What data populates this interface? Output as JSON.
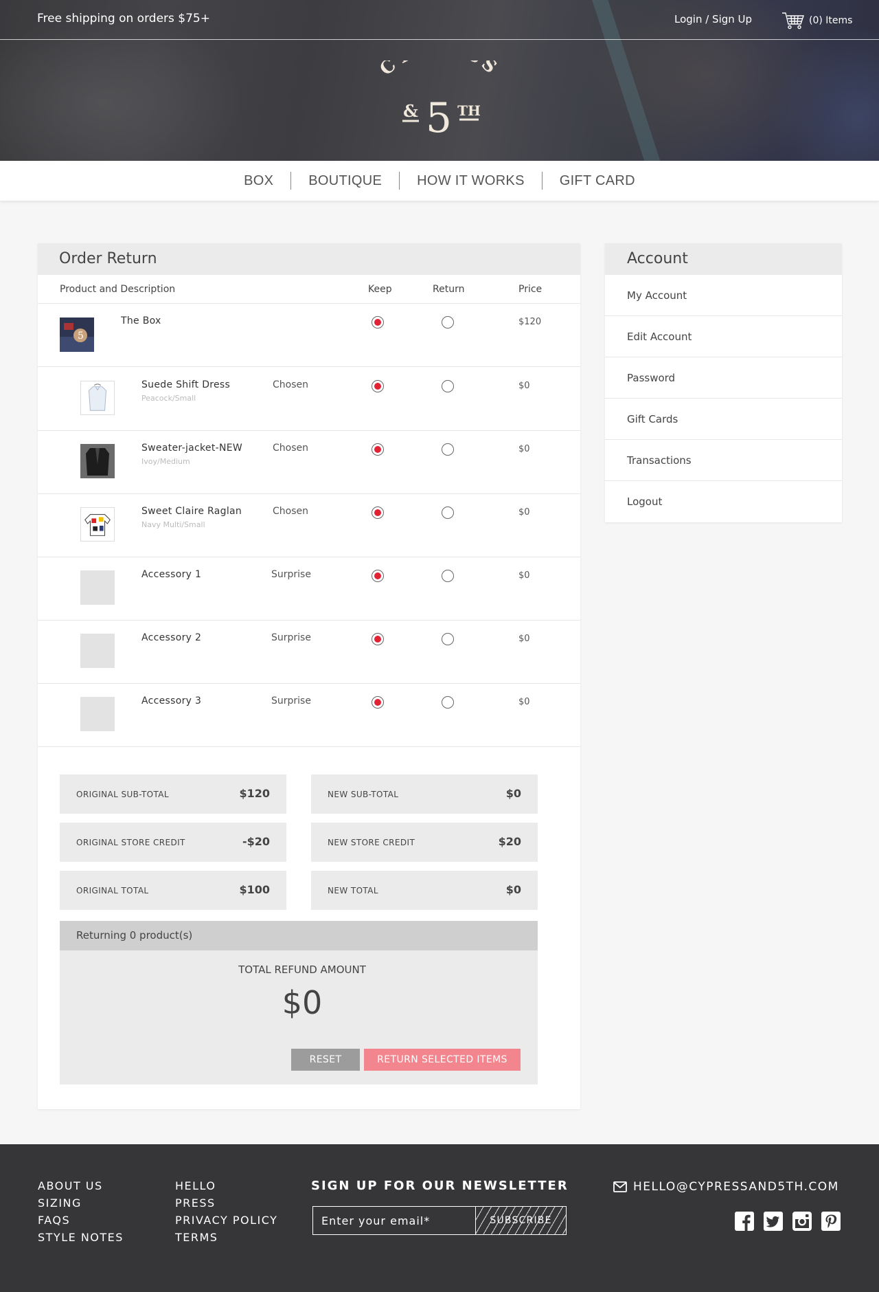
{
  "header": {
    "shipping_text": "Free shipping on orders $75+",
    "login_text": "Login / Sign Up",
    "cart_text": "(0) Items",
    "logo": {
      "line1": "CYPRESS",
      "line2_amp": "&",
      "line2_num": "5",
      "line2_sup": "TH"
    }
  },
  "nav": {
    "items": [
      "BOX",
      "BOUTIQUE",
      "HOW IT WORKS",
      "GIFT CARD"
    ]
  },
  "order": {
    "title": "Order Return",
    "columns": {
      "product": "Product and Description",
      "keep": "Keep",
      "return": "Return",
      "price": "Price"
    },
    "items": [
      {
        "name": "The Box",
        "variant": "",
        "type": "",
        "keep": true,
        "price": "$120"
      },
      {
        "name": "Suede Shift Dress",
        "variant": "Peacock/Small",
        "type": "Chosen",
        "keep": true,
        "price": "$0"
      },
      {
        "name": "Sweater-jacket-NEW",
        "variant": "Ivoy/Medium",
        "type": "Chosen",
        "keep": true,
        "price": "$0"
      },
      {
        "name": "Sweet Claire Raglan",
        "variant": "Navy Multi/Small",
        "type": "Chosen",
        "keep": true,
        "price": "$0"
      },
      {
        "name": "Accessory 1",
        "variant": "",
        "type": "Surprise",
        "keep": true,
        "price": "$0"
      },
      {
        "name": "Accessory 2",
        "variant": "",
        "type": "Surprise",
        "keep": true,
        "price": "$0"
      },
      {
        "name": "Accessory 3",
        "variant": "",
        "type": "Surprise",
        "keep": true,
        "price": "$0"
      }
    ],
    "summary": {
      "original_subtotal_label": "ORIGINAL SUB-TOTAL",
      "original_subtotal": "$120",
      "original_credit_label": "ORIGINAL STORE CREDIT",
      "original_credit": "-$20",
      "original_total_label": "ORIGINAL TOTAL",
      "original_total": "$100",
      "new_subtotal_label": "NEW SUB-TOTAL",
      "new_subtotal": "$0",
      "new_credit_label": "NEW STORE CREDIT",
      "new_credit": "$20",
      "new_total_label": "NEW TOTAL",
      "new_total": "$0"
    },
    "refund": {
      "returning_text": "Returning 0 product(s)",
      "label": "TOTAL REFUND AMOUNT",
      "amount": "$0",
      "reset_label": "RESET",
      "return_label": "RETURN SELECTED ITEMS"
    }
  },
  "account": {
    "title": "Account",
    "items": [
      "My Account",
      "Edit Account",
      "Password",
      "Gift Cards",
      "Transactions",
      "Logout"
    ]
  },
  "footer": {
    "col1": [
      "ABOUT US",
      "SIZING",
      "FAQS",
      "STYLE NOTES"
    ],
    "col2": [
      "HELLO",
      "PRESS",
      "PRIVACY POLICY",
      "TERMS"
    ],
    "newsletter_title": "SIGN UP FOR OUR NEWSLETTER",
    "newsletter_placeholder": "Enter your email*",
    "subscribe_label": "SUBSCRIBE",
    "email": "HELLO@CYPRESSAND5TH.COM",
    "social": [
      "facebook-icon",
      "twitter-icon",
      "instagram-icon",
      "pinterest-icon"
    ]
  },
  "colors": {
    "accent_red": "#e02335",
    "return_button": "#f2858d",
    "reset_button": "#9c9c9c",
    "footer_bg": "#363638"
  }
}
